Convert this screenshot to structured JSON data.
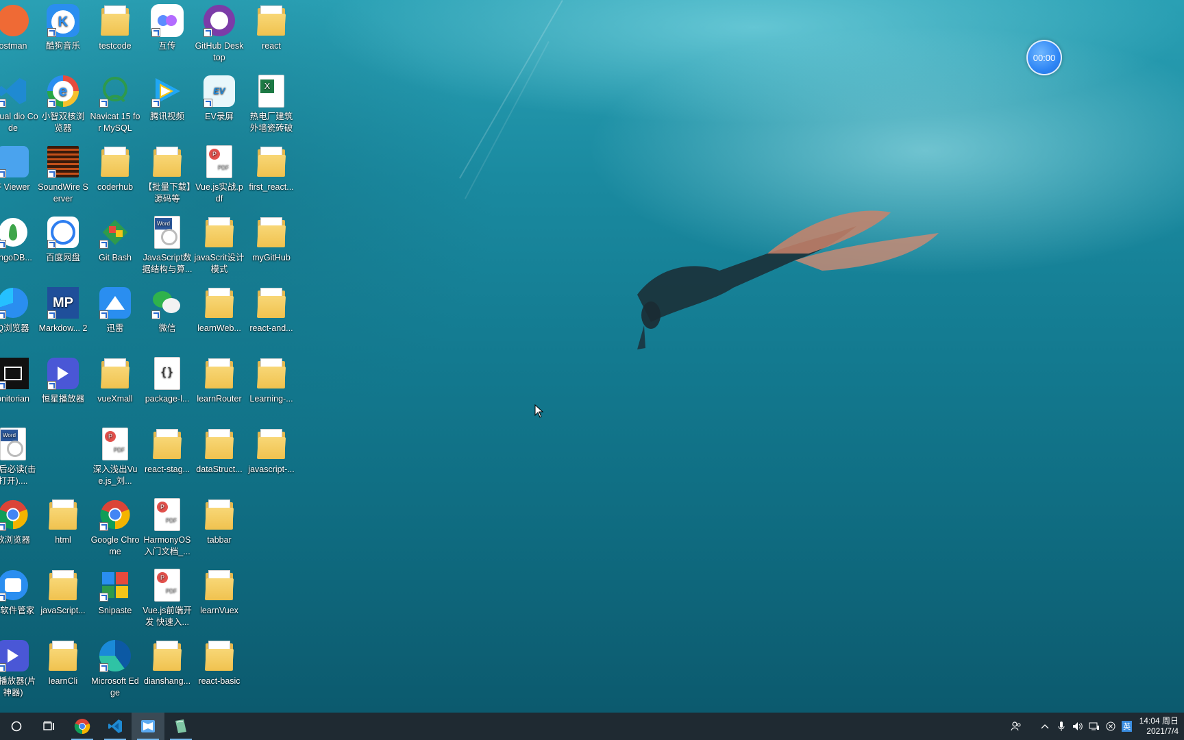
{
  "desktop": {
    "icons": [
      {
        "label": "ostman",
        "kind": "postman"
      },
      {
        "label": "酷狗音乐",
        "kind": "kugou"
      },
      {
        "label": "testcode",
        "kind": "folder"
      },
      {
        "label": "互传",
        "kind": "huchuan"
      },
      {
        "label": "GitHub Desktop",
        "kind": "github"
      },
      {
        "label": "react",
        "kind": "folder"
      },
      {
        "label": "Visual\ndio Code",
        "kind": "vscode"
      },
      {
        "label": "小智双核浏览器",
        "kind": "browser-e"
      },
      {
        "label": "Navicat 15 for MySQL",
        "kind": "navicat"
      },
      {
        "label": "腾讯视频",
        "kind": "tencent-video"
      },
      {
        "label": "EV录屏",
        "kind": "ev"
      },
      {
        "label": "热电厂建筑外墙瓷砖破损...",
        "kind": "excel"
      },
      {
        "label": "F Viewer",
        "kind": "pdfviewer"
      },
      {
        "label": "SoundWire Server",
        "kind": "soundwire"
      },
      {
        "label": "coderhub",
        "kind": "folder"
      },
      {
        "label": "【批量下载】源码等",
        "kind": "folder"
      },
      {
        "label": "Vue.js实战.pdf",
        "kind": "pdf"
      },
      {
        "label": "first_react...",
        "kind": "folder"
      },
      {
        "label": "ongoDB...",
        "kind": "mongodb"
      },
      {
        "label": "百度网盘",
        "kind": "baidu"
      },
      {
        "label": "Git Bash",
        "kind": "gitbash"
      },
      {
        "label": "JavaScript数据结构与算...",
        "kind": "word"
      },
      {
        "label": "javaScrit设计模式",
        "kind": "folder"
      },
      {
        "label": "myGitHub",
        "kind": "folder"
      },
      {
        "label": "Q浏览器",
        "kind": "qqbrowser"
      },
      {
        "label": "Markdow... 2",
        "kind": "mp"
      },
      {
        "label": "迅雷",
        "kind": "xunlei"
      },
      {
        "label": "微信",
        "kind": "wechat"
      },
      {
        "label": "learnWeb...",
        "kind": "folder"
      },
      {
        "label": "react-and...",
        "kind": "folder"
      },
      {
        "label": "onitorian",
        "kind": "monitorian"
      },
      {
        "label": "恒星播放器",
        "kind": "player"
      },
      {
        "label": "vueXmall",
        "kind": "folder"
      },
      {
        "label": "package-l...",
        "kind": "json"
      },
      {
        "label": "learnRouter",
        "kind": "folder"
      },
      {
        "label": "Learning-...",
        "kind": "folder"
      },
      {
        "label": "机后必读(击打开)....",
        "kind": "word"
      },
      {
        "label": "深入浅出Vue.js_刘...",
        "kind": "pdf"
      },
      {
        "label": "react-stag...",
        "kind": "folder"
      },
      {
        "label": "dataStruct...",
        "kind": "folder"
      },
      {
        "label": "javascript-...",
        "kind": "folder"
      },
      {
        "label": "歌浏览器",
        "kind": "chrome"
      },
      {
        "label": "html",
        "kind": "folder"
      },
      {
        "label": "Google Chrome",
        "kind": "chrome"
      },
      {
        "label": "HarmonyOS入门文档_...",
        "kind": "pdf"
      },
      {
        "label": "tabbar",
        "kind": "folder"
      },
      {
        "label": "星软件管家",
        "kind": "softmgr"
      },
      {
        "label": "javaScript...",
        "kind": "folder"
      },
      {
        "label": "Snipaste",
        "kind": "snipaste"
      },
      {
        "label": "Vue.js前端开发 快速入...",
        "kind": "pdf"
      },
      {
        "label": "learnVuex",
        "kind": "folder"
      },
      {
        "label": "星播放器(片神器)",
        "kind": "player"
      },
      {
        "label": "learnCli",
        "kind": "folder"
      },
      {
        "label": "Microsoft Edge",
        "kind": "edge"
      },
      {
        "label": "dianshang...",
        "kind": "folder"
      },
      {
        "label": "react-basic",
        "kind": "folder"
      }
    ]
  },
  "timer": {
    "text": "00:00"
  },
  "taskbar": {
    "apps": [
      "search-icon",
      "task-view-icon",
      "chrome-icon",
      "vscode-icon",
      "pdf-viewer-icon",
      "notepad-icon"
    ],
    "tray": {
      "input_method": "英",
      "clock_time": "14:04 周日",
      "clock_date": "2021/7/4"
    }
  }
}
